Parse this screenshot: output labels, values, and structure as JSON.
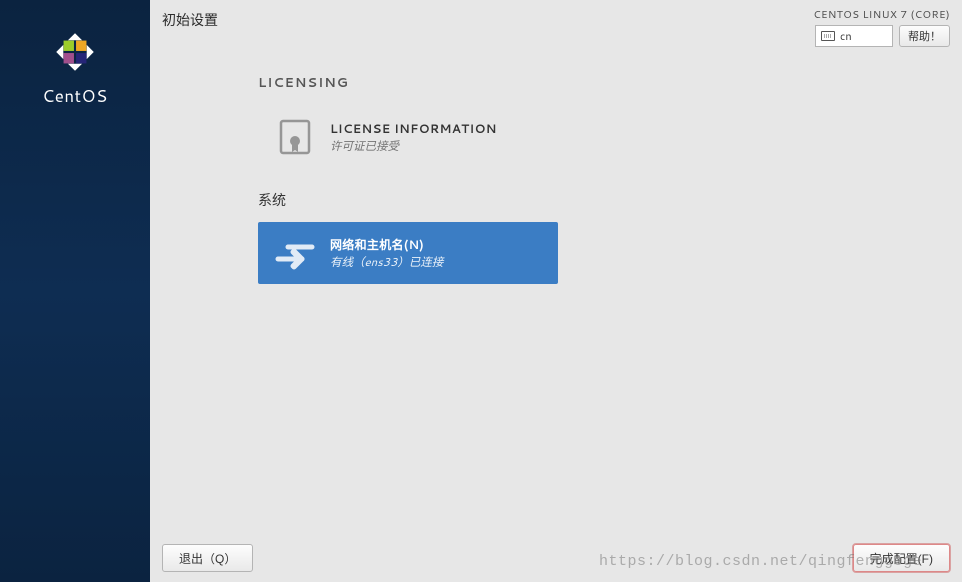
{
  "sidebar": {
    "product_name": "CentOS"
  },
  "header": {
    "page_title": "初始设置",
    "distro": "CENTOS LINUX 7 (CORE)",
    "lang_code": "cn",
    "help_label": "帮助！"
  },
  "sections": {
    "licensing": {
      "title": "LICENSING",
      "spoke": {
        "title": "LICENSE INFORMATION",
        "subtitle": "许可证已接受"
      }
    },
    "system": {
      "title": "系统",
      "spoke": {
        "title": "网络和主机名(N)",
        "subtitle": "有线（ens33）已连接"
      }
    }
  },
  "footer": {
    "quit_label": "退出（Q）",
    "finish_label": "完成配置(F)"
  },
  "watermark": "https://blog.csdn.net/qingfenggege"
}
